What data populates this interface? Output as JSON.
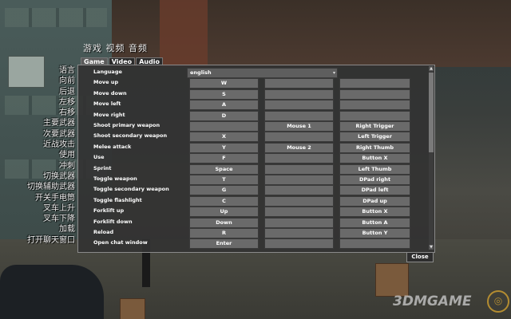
{
  "header": {
    "title": "游戏  视频  音频"
  },
  "tabs": [
    {
      "label": "Game",
      "active": true
    },
    {
      "label": "Video",
      "active": false
    },
    {
      "label": "Audio",
      "active": false
    }
  ],
  "cn_labels": [
    "语言",
    "向前",
    "后退",
    "左移",
    "右移",
    "主要武器",
    "次要武器",
    "近战攻击",
    "使用",
    "冲刺",
    "切换武器",
    "切换辅助武器",
    "开关手电筒",
    "叉车上升",
    "叉车下降",
    "加载",
    "打开聊天窗口"
  ],
  "language": {
    "label": "Language",
    "value": "english"
  },
  "bindings": [
    {
      "action": "Move up",
      "key1": "W",
      "key2": "",
      "pad": ""
    },
    {
      "action": "Move down",
      "key1": "S",
      "key2": "",
      "pad": ""
    },
    {
      "action": "Move left",
      "key1": "A",
      "key2": "",
      "pad": ""
    },
    {
      "action": "Move right",
      "key1": "D",
      "key2": "",
      "pad": ""
    },
    {
      "action": "Shoot primary weapon",
      "key1": "",
      "key2": "Mouse 1",
      "pad": "Right Trigger"
    },
    {
      "action": "Shoot secondary weapon",
      "key1": "X",
      "key2": "",
      "pad": "Left Trigger"
    },
    {
      "action": "Melee attack",
      "key1": "Y",
      "key2": "Mouse 2",
      "pad": "Right Thumb"
    },
    {
      "action": "Use",
      "key1": "F",
      "key2": "",
      "pad": "Button X"
    },
    {
      "action": "Sprint",
      "key1": "Space",
      "key2": "",
      "pad": "Left Thumb"
    },
    {
      "action": "Toggle weapon",
      "key1": "T",
      "key2": "",
      "pad": "DPad right"
    },
    {
      "action": "Toggle secondary weapon",
      "key1": "G",
      "key2": "",
      "pad": "DPad left"
    },
    {
      "action": "Toggle flashlight",
      "key1": "C",
      "key2": "",
      "pad": "DPad up"
    },
    {
      "action": "Forklift up",
      "key1": "Up",
      "key2": "",
      "pad": "Button X"
    },
    {
      "action": "Forklift down",
      "key1": "Down",
      "key2": "",
      "pad": "Button A"
    },
    {
      "action": "Reload",
      "key1": "R",
      "key2": "",
      "pad": "Button Y"
    },
    {
      "action": "Open chat window",
      "key1": "Enter",
      "key2": "",
      "pad": ""
    }
  ],
  "close_label": "Close",
  "watermark": "3DMGAME",
  "icons": {
    "lang_dropdown": "chevron-down-icon",
    "scroll_up": "arrow-up-icon",
    "scroll_down": "arrow-down-icon"
  }
}
